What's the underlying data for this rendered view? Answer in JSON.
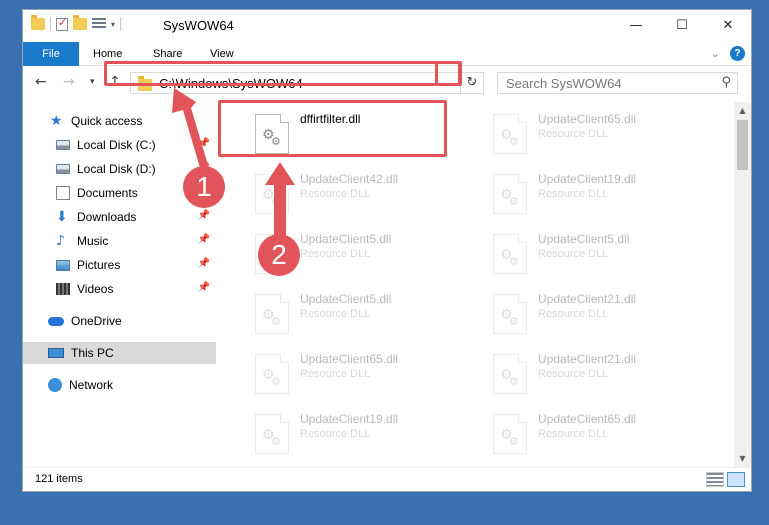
{
  "window": {
    "title": "SysWOW64",
    "minimize_icon": "minimize-icon",
    "maximize_icon": "maximize-icon",
    "close_icon": "close-icon"
  },
  "ribbon": {
    "tabs": [
      {
        "label": "File"
      },
      {
        "label": "Home"
      },
      {
        "label": "Share"
      },
      {
        "label": "View"
      }
    ]
  },
  "address": {
    "path": "C:\\Windows\\SysWOW64"
  },
  "search": {
    "placeholder": "Search SysWOW64"
  },
  "nav": {
    "items": [
      {
        "label": "Quick access",
        "pinned": false
      },
      {
        "label": "Local Disk (C:)",
        "pinned": true
      },
      {
        "label": "Local Disk (D:)",
        "pinned": true
      },
      {
        "label": "Documents",
        "pinned": true
      },
      {
        "label": "Downloads",
        "pinned": true
      },
      {
        "label": "Music",
        "pinned": true
      },
      {
        "label": "Pictures",
        "pinned": true
      },
      {
        "label": "Videos",
        "pinned": true
      },
      {
        "label": "OneDrive",
        "pinned": false
      },
      {
        "label": "This PC",
        "pinned": false,
        "selected": true
      },
      {
        "label": "Network",
        "pinned": false
      }
    ]
  },
  "files": [
    {
      "name": "dffirtfilter.dll",
      "type": ""
    },
    {
      "name": "UpdateClient65.dll",
      "type": "Resource DLL"
    },
    {
      "name": "UpdateClient42.dll",
      "type": "Resource DLL"
    },
    {
      "name": "UpdateClient19.dll",
      "type": "Resource DLL"
    },
    {
      "name": "UpdateClient5.dll",
      "type": "Resource DLL"
    },
    {
      "name": "UpdateClient5.dll",
      "type": "Resource DLL"
    },
    {
      "name": "UpdateClient5.dll",
      "type": "Resource DLL"
    },
    {
      "name": "UpdateClient21.dll",
      "type": "Resource DLL"
    },
    {
      "name": "UpdateClient65.dll",
      "type": "Resource DLL"
    },
    {
      "name": "UpdateClient21.dll",
      "type": "Resource DLL"
    },
    {
      "name": "UpdateClient19.dll",
      "type": "Resource DLL"
    },
    {
      "name": "UpdateClient65.dll",
      "type": "Resource DLL"
    }
  ],
  "status": {
    "item_count": "121 items"
  },
  "annotations": {
    "step1": "1",
    "step2": "2",
    "highlight_color": "#e0545a"
  }
}
